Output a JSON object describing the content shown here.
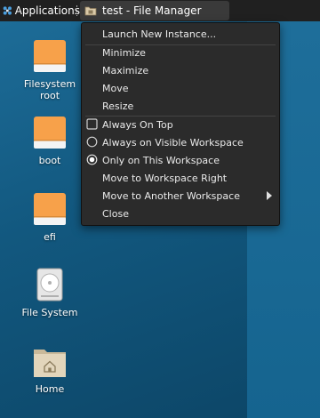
{
  "panel": {
    "applications_label": "Applications",
    "task_label": "test - File Manager"
  },
  "desktop": {
    "icons": [
      {
        "label_line1": "Filesystem",
        "label_line2": "root",
        "icon": "drive-icon"
      },
      {
        "label": "boot",
        "icon": "drive-icon"
      },
      {
        "label": "efi",
        "icon": "drive-icon"
      },
      {
        "label": "File System",
        "icon": "harddisk-icon"
      },
      {
        "label": "Home",
        "icon": "home-folder-icon"
      }
    ]
  },
  "window_menu": {
    "items": [
      {
        "label": "Launch New Instance..."
      },
      {
        "label": "Minimize"
      },
      {
        "label": "Maximize"
      },
      {
        "label": "Move"
      },
      {
        "label": "Resize"
      },
      {
        "label": "Always On Top",
        "control": "checkbox",
        "checked": false
      },
      {
        "label": "Always on Visible Workspace",
        "control": "radio",
        "selected": false
      },
      {
        "label": "Only on This Workspace",
        "control": "radio",
        "selected": true
      },
      {
        "label": "Move to Workspace Right"
      },
      {
        "label": "Move to Another Workspace",
        "submenu": true
      },
      {
        "label": "Close"
      }
    ]
  },
  "colors": {
    "desktop_bg": "#15648f",
    "panel_bg": "#202020",
    "menu_bg": "#2b2b2b",
    "drive_orange": "#f7a14a"
  }
}
